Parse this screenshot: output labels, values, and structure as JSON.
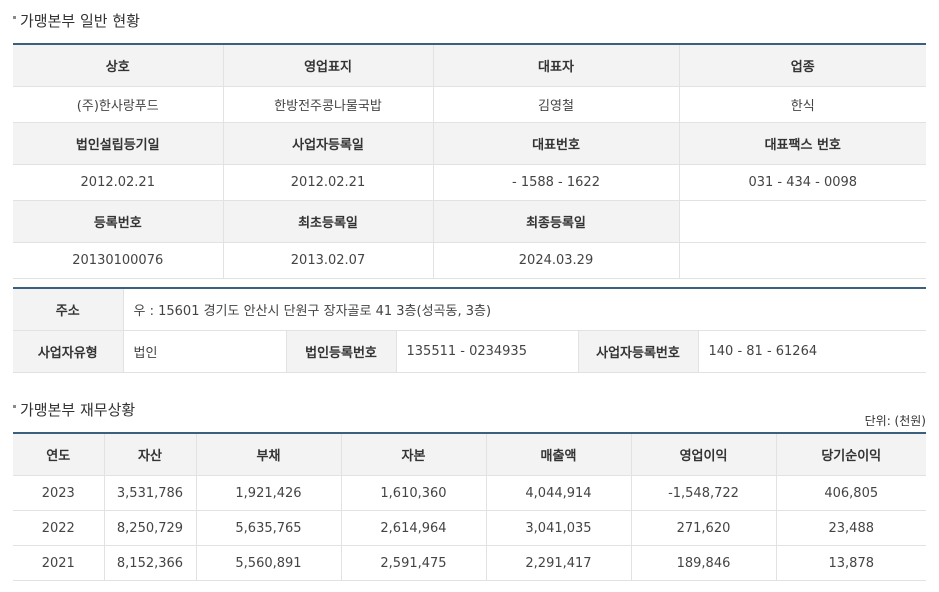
{
  "general": {
    "title": "가맹본부 일반 현황",
    "row1_headers": [
      "상호",
      "영업표지",
      "대표자",
      "업종"
    ],
    "row1_values": [
      "(주)한사랑푸드",
      "한방전주콩나물국밥",
      "김영철",
      "한식"
    ],
    "row2_headers": [
      "법인설립등기일",
      "사업자등록일",
      "대표번호",
      "대표팩스 번호"
    ],
    "row2_values": [
      "2012.02.21",
      "2012.02.21",
      "- 1588 - 1622",
      "031 - 434 - 0098"
    ],
    "row3_headers": [
      "등록번호",
      "최초등록일",
      "최종등록일"
    ],
    "row3_values": [
      "20130100076",
      "2013.02.07",
      "2024.03.29",
      ""
    ]
  },
  "address": {
    "label": "주소",
    "value": "우 : 15601 경기도 안산시 단원구 장자골로 41 3층(성곡동, 3층)",
    "biz_type_label": "사업자유형",
    "biz_type_value": "법인",
    "corp_reg_label": "법인등록번호",
    "corp_reg_value": "135511 - 0234935",
    "biz_reg_label": "사업자등록번호",
    "biz_reg_value": "140 - 81 - 61264"
  },
  "finance": {
    "title": "가맹본부 재무상황",
    "unit": "단위: (천원)",
    "headers": [
      "연도",
      "자산",
      "부채",
      "자본",
      "매출액",
      "영업이익",
      "당기순이익"
    ],
    "rows": [
      [
        "2023",
        "3,531,786",
        "1,921,426",
        "1,610,360",
        "4,044,914",
        "-1,548,722",
        "406,805"
      ],
      [
        "2022",
        "8,250,729",
        "5,635,765",
        "2,614,964",
        "3,041,035",
        "271,620",
        "23,488"
      ],
      [
        "2021",
        "8,152,366",
        "5,560,891",
        "2,591,475",
        "2,291,417",
        "189,846",
        "13,878"
      ]
    ]
  }
}
